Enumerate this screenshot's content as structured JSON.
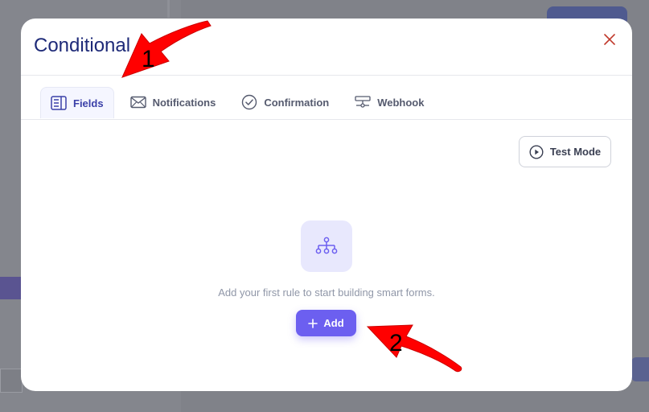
{
  "modal": {
    "title": "Conditional",
    "close_icon": "close-icon"
  },
  "tabs": [
    {
      "label": "Fields",
      "icon": "fields-icon",
      "active": true
    },
    {
      "label": "Notifications",
      "icon": "envelope-icon",
      "active": false
    },
    {
      "label": "Confirmation",
      "icon": "check-circle-icon",
      "active": false
    },
    {
      "label": "Webhook",
      "icon": "webhook-icon",
      "active": false
    }
  ],
  "toolbar": {
    "test_mode_label": "Test Mode",
    "test_mode_icon": "play-circle-icon"
  },
  "empty_state": {
    "icon": "sitemap-icon",
    "message": "Add your first rule to start building smart forms.",
    "add_label": "Add",
    "add_icon": "plus-icon"
  },
  "annotations": {
    "arrow_1_label": "1",
    "arrow_2_label": "2"
  },
  "colors": {
    "accent": "#6c5ff0",
    "title": "#1e2a78",
    "close": "#c0392b",
    "annotation_arrow": "#ff0000",
    "overlay": "#808289"
  }
}
